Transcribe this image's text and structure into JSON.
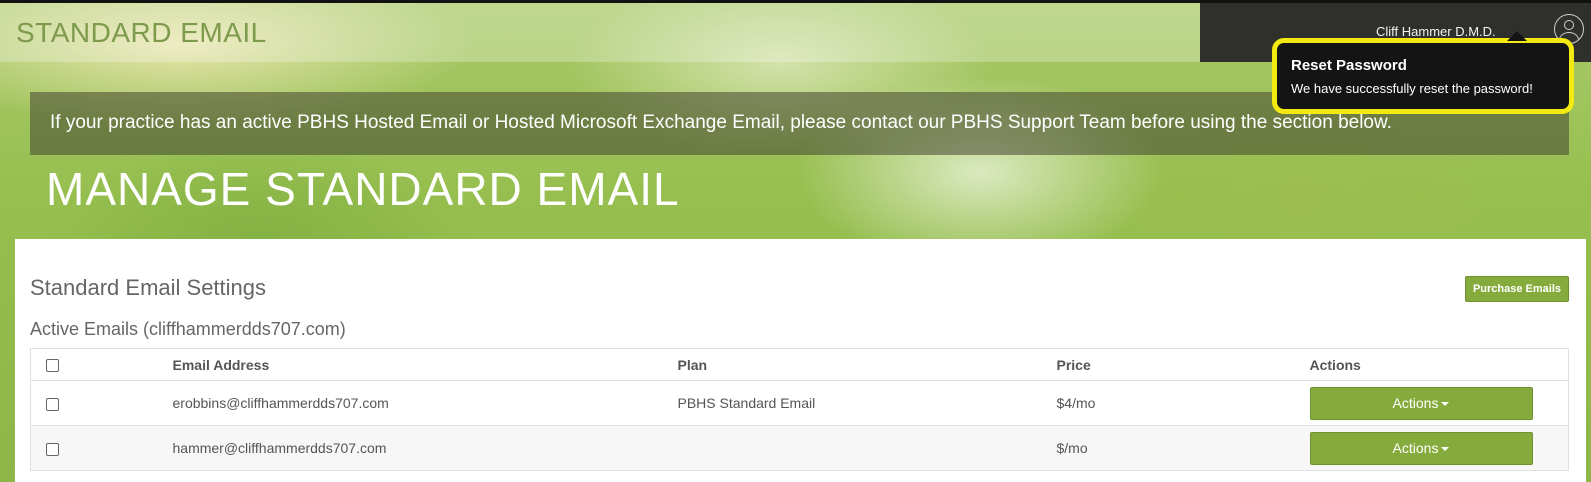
{
  "header": {
    "site_title": "STANDARD EMAIL",
    "user_name": "Cliff Hammer D.M.D."
  },
  "toast": {
    "title": "Reset Password",
    "message": "We have successfully reset the password!"
  },
  "notice": "If your practice has an active PBHS Hosted Email or Hosted Microsoft Exchange Email, please contact our PBHS Support Team before using the section below.",
  "page_heading": "MANAGE STANDARD EMAIL",
  "settings": {
    "title": "Standard Email Settings",
    "purchase_label": "Purchase Emails",
    "active_title": "Active Emails (cliffhammerdds707.com)"
  },
  "table": {
    "headers": [
      "Email Address",
      "Plan",
      "Price",
      "Actions"
    ],
    "rows": [
      {
        "email": "erobbins@cliffhammerdds707.com",
        "plan": "PBHS Standard Email",
        "price": "$4/mo",
        "action": "Actions"
      },
      {
        "email": "hammer@cliffhammerdds707.com",
        "plan": "",
        "price": "$/mo",
        "action": "Actions"
      }
    ]
  },
  "colors": {
    "accent": "#86ab3d",
    "toast_highlight": "#f2ea10",
    "user_panel": "#2f2f2b"
  }
}
